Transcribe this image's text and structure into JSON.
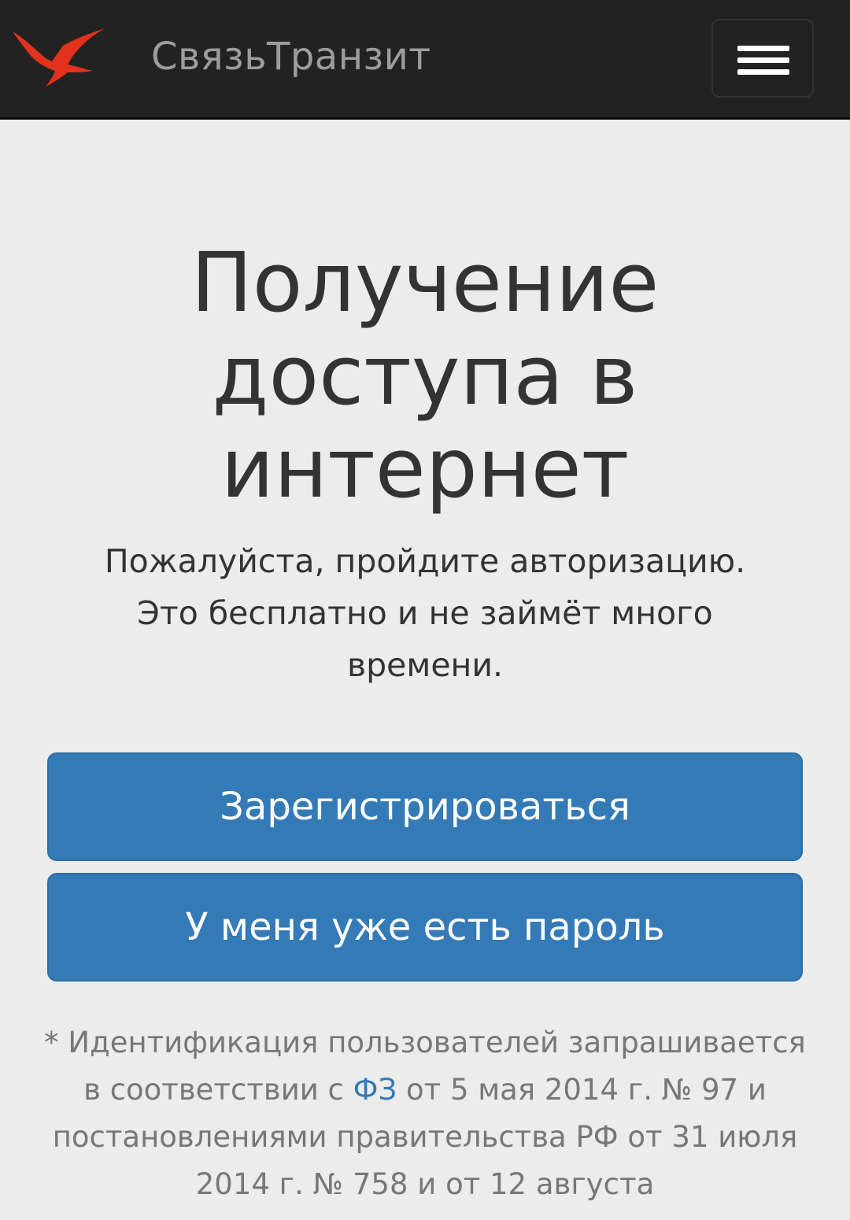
{
  "header": {
    "logo_icon": "bird-logo-icon",
    "brand": "СвязьТранзит",
    "menu_icon": "hamburger-menu-icon"
  },
  "main": {
    "title": "Получение доступа в интернет",
    "lead": "Пожалуйста, пройдите авторизацию. Это бесплатно и не займёт много времени.",
    "buttons": {
      "register": "Зарегистрироваться",
      "login": "У меня уже есть пароль"
    },
    "note": {
      "before_link": "* Идентификация пользователей запрашивается в соответствии с ",
      "link": "ФЗ",
      "after_link": " от 5 мая 2014 г. № 97 и постановлениями правительства РФ от 31 июля 2014 г. № 758 и от 12 августа"
    }
  },
  "colors": {
    "navbar_bg": "#222222",
    "brand_text": "#9d9d9d",
    "logo_red": "#e2321d",
    "page_bg": "#ececec",
    "button_primary": "#337ab7",
    "link": "#337ab7",
    "muted_text": "#777777"
  }
}
